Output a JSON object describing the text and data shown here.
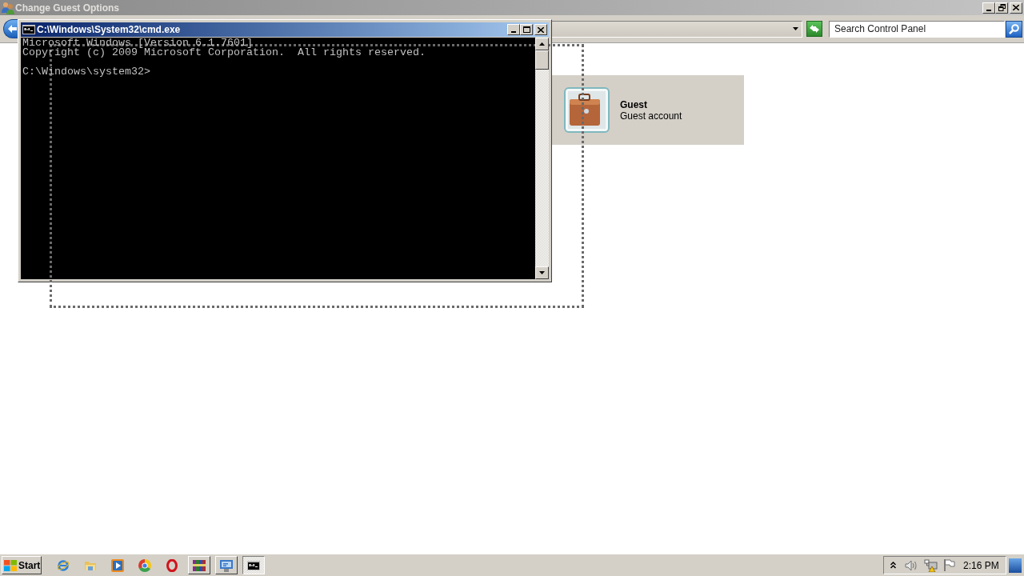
{
  "control_panel": {
    "title": "Change Guest Options",
    "search": {
      "placeholder": "Search Control Panel"
    },
    "account": {
      "name": "Guest",
      "description": "Guest account"
    }
  },
  "console": {
    "title": "C:\\Windows\\System32\\cmd.exe",
    "output_lines": [
      "Microsoft Windows [Version 6.1.7601]",
      "Copyright (c) 2009 Microsoft Corporation.  All rights reserved."
    ],
    "prompt": "C:\\Windows\\system32>"
  },
  "taskbar": {
    "start_label": "Start",
    "apps": [
      {
        "kind": "shortcut",
        "selected": false
      },
      {
        "kind": "shortcut",
        "selected": false
      },
      {
        "kind": "shortcut",
        "selected": false
      },
      {
        "kind": "shortcut",
        "selected": false
      },
      {
        "kind": "shortcut",
        "selected": false
      },
      {
        "kind": "window",
        "selected": false
      },
      {
        "kind": "window",
        "selected": false
      },
      {
        "kind": "window",
        "selected": true
      }
    ],
    "clock": "2:16 PM"
  }
}
